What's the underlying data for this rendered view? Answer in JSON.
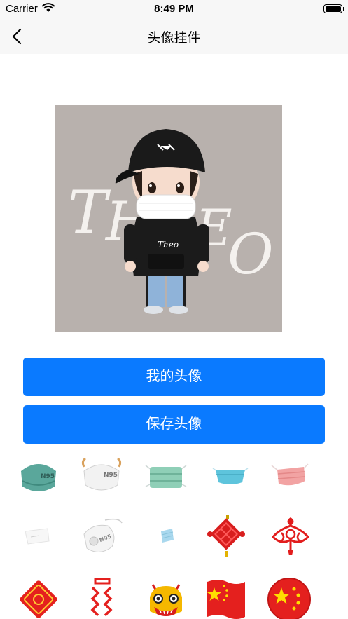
{
  "status_bar": {
    "carrier": "Carrier",
    "time": "8:49 PM",
    "battery_level": 1.0
  },
  "nav": {
    "title": "头像挂件",
    "back_icon": "chevron-left-icon"
  },
  "avatar": {
    "lettering": [
      "T",
      "H",
      "E",
      "O"
    ],
    "shirt_text": "Theo",
    "background_color": "#b8b1ad"
  },
  "buttons": {
    "my_avatar": "我的头像",
    "save_avatar": "保存头像"
  },
  "stickers": [
    {
      "name": "n95-mask-green-icon"
    },
    {
      "name": "n95-mask-white-icon"
    },
    {
      "name": "surgical-mask-green-icon"
    },
    {
      "name": "surgical-mask-blue-icon"
    },
    {
      "name": "surgical-mask-pink-icon"
    },
    {
      "name": "paper-mask-white-icon"
    },
    {
      "name": "n95-valve-mask-white-icon"
    },
    {
      "name": "small-mask-blue-icon"
    },
    {
      "name": "chinese-knot-diamond-icon"
    },
    {
      "name": "chinese-knot-ornate-icon"
    },
    {
      "name": "lucky-knot-tile-icon"
    },
    {
      "name": "firecracker-chain-icon"
    },
    {
      "name": "lion-dance-head-icon"
    },
    {
      "name": "china-flag-icon"
    },
    {
      "name": "china-flag-badge-icon"
    }
  ],
  "colors": {
    "accent": "#0a7aff",
    "nav_background": "#f7f7f7",
    "festive_red": "#e4201e",
    "gold": "#ffcc00"
  }
}
